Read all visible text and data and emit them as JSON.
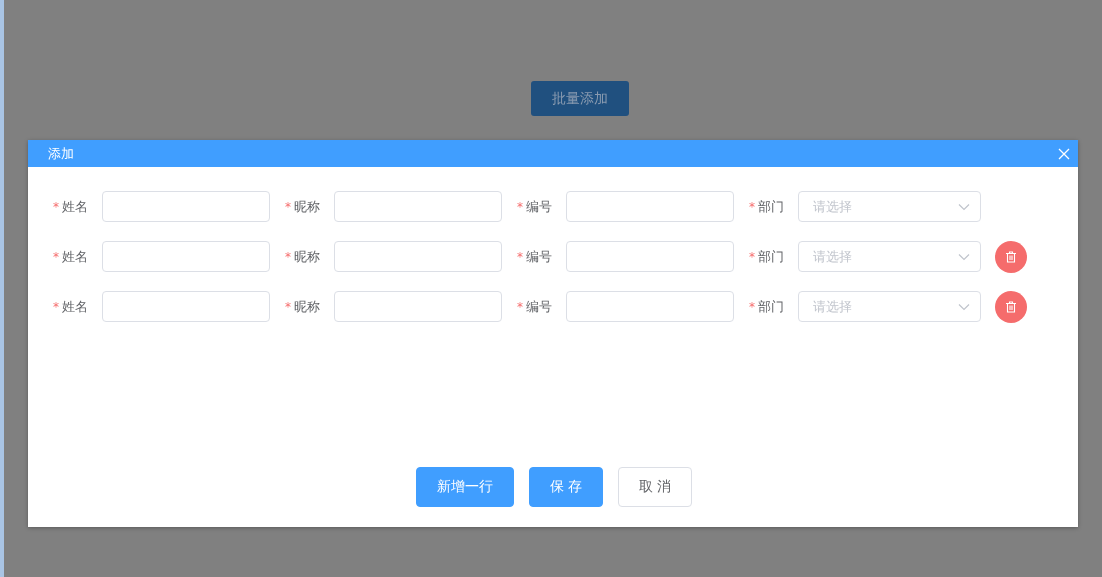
{
  "page": {
    "batch_add_button": "批量添加"
  },
  "dialog": {
    "title": "添加",
    "rows": [
      {
        "deletable": false,
        "fields": [
          {
            "kind": "input",
            "label": "姓名",
            "required_mark": "*"
          },
          {
            "kind": "input",
            "label": "昵称",
            "required_mark": "*"
          },
          {
            "kind": "input",
            "label": "编号",
            "required_mark": "*"
          },
          {
            "kind": "select",
            "label": "部门",
            "required_mark": "*",
            "placeholder": "请选择"
          }
        ]
      },
      {
        "deletable": true,
        "fields": [
          {
            "kind": "input",
            "label": "姓名",
            "required_mark": "*"
          },
          {
            "kind": "input",
            "label": "昵称",
            "required_mark": "*"
          },
          {
            "kind": "input",
            "label": "编号",
            "required_mark": "*"
          },
          {
            "kind": "select",
            "label": "部门",
            "required_mark": "*",
            "placeholder": "请选择"
          }
        ]
      },
      {
        "deletable": true,
        "fields": [
          {
            "kind": "input",
            "label": "姓名",
            "required_mark": "*"
          },
          {
            "kind": "input",
            "label": "昵称",
            "required_mark": "*"
          },
          {
            "kind": "input",
            "label": "编号",
            "required_mark": "*"
          },
          {
            "kind": "select",
            "label": "部门",
            "required_mark": "*",
            "placeholder": "请选择"
          }
        ]
      }
    ],
    "buttons": [
      {
        "label": "新增一行",
        "kind": "primary"
      },
      {
        "label": "保 存",
        "kind": "primary"
      },
      {
        "label": "取 消",
        "kind": "default"
      }
    ]
  }
}
